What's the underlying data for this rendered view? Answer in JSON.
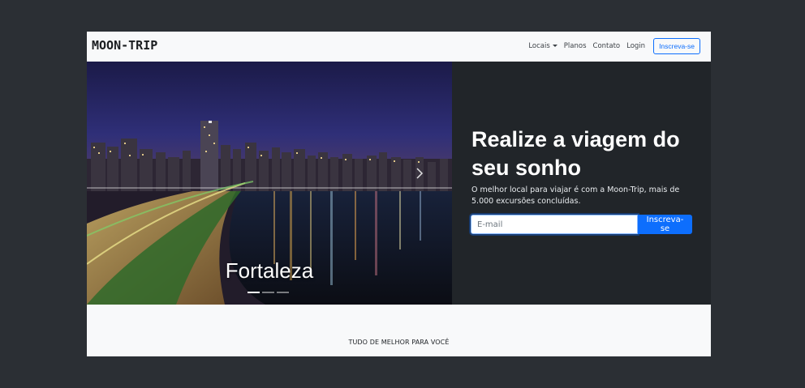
{
  "navbar": {
    "brand": "MOON-TRIP",
    "links": {
      "locais": "Locais",
      "planos": "Planos",
      "contato": "Contato",
      "login": "Login"
    },
    "signup_button": "Inscreva-se"
  },
  "hero": {
    "carousel": {
      "caption": "Fortaleza",
      "slides_count": 3,
      "active_slide": 1
    },
    "title": "Realize a viagem do seu sonho",
    "subtitle": "O melhor local para viajar é com a Moon-Trip, mais de 5.000 excursões concluídas.",
    "email_placeholder": "E-mail",
    "signup_button": "Inscreva-se"
  },
  "section": {
    "title": "TUDO DE MELHOR PARA VOCÊ"
  },
  "colors": {
    "background": "#2b2f34",
    "navbar": "#f8f9fa",
    "hero_dark": "#212529",
    "primary": "#0d6efd"
  }
}
